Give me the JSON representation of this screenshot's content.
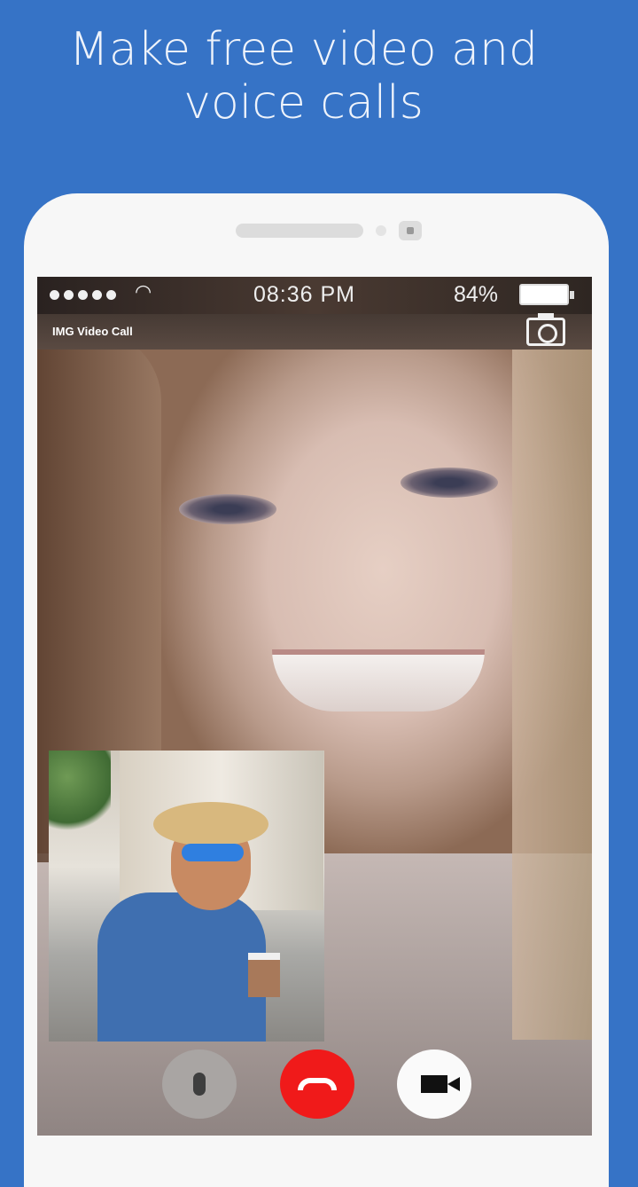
{
  "headline": {
    "line1": "Make free video and",
    "line2": "voice calls"
  },
  "status_bar": {
    "time": "08:36 PM",
    "battery": "84%",
    "battery_level": 0.84
  },
  "app": {
    "title": "IMG Video Call"
  },
  "controls": {
    "mute": "microphone-icon",
    "end": "end-call-icon",
    "video": "video-camera-icon"
  },
  "colors": {
    "background": "#3673c6",
    "end_call": "#f01a1a"
  }
}
